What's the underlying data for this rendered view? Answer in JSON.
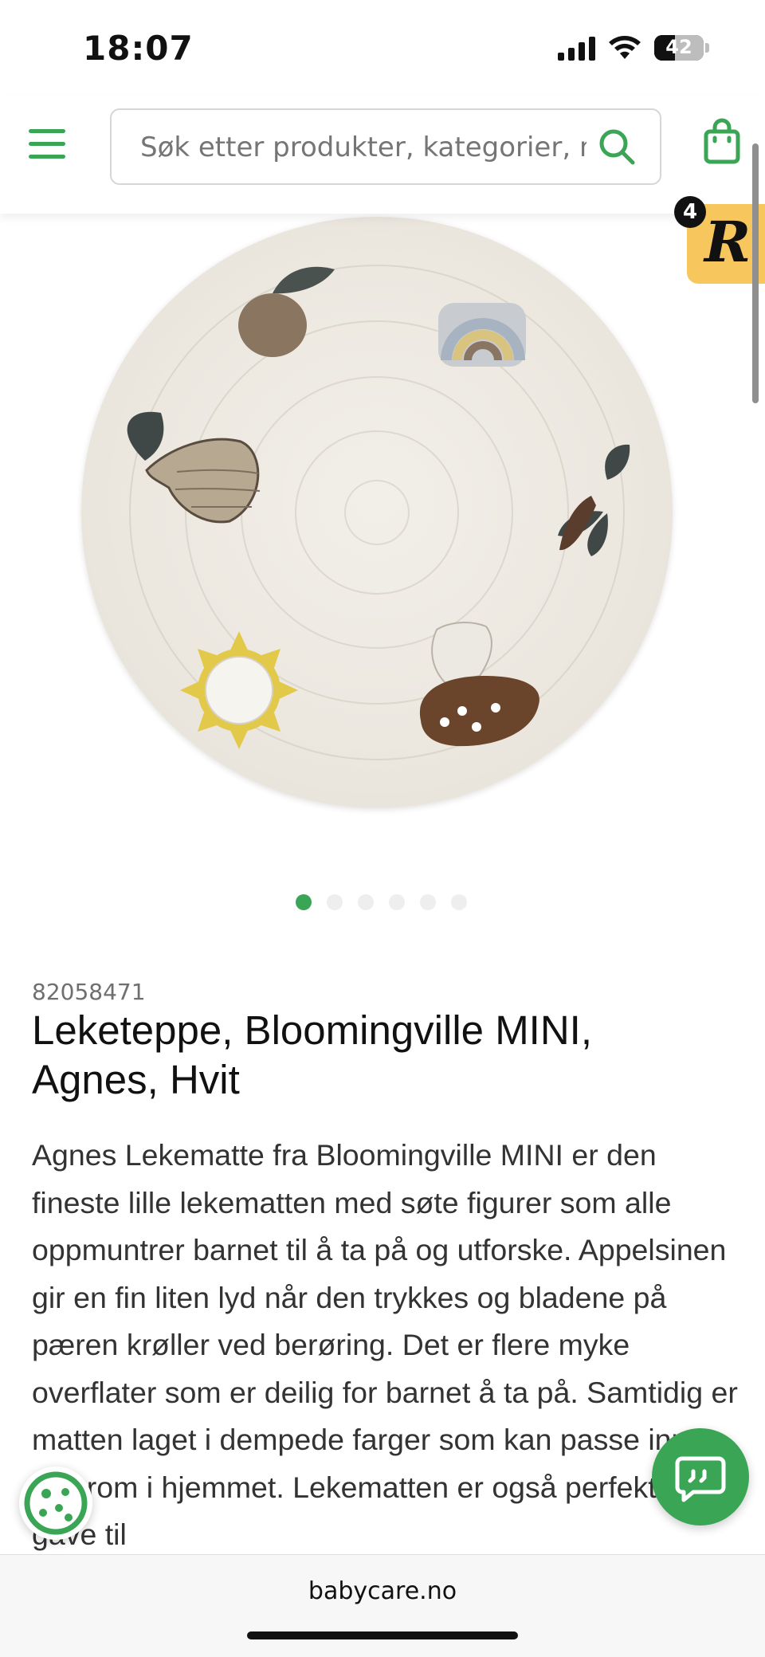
{
  "status_bar": {
    "time": "18:07",
    "battery": "42"
  },
  "header": {
    "search_placeholder": "Søk etter produkter, kategorier, merker"
  },
  "floating_badge": {
    "count": "4",
    "letter": "R"
  },
  "carousel": {
    "total": 6,
    "active": 1
  },
  "product": {
    "sku": "82058471",
    "title": "Leketeppe, Bloomingville MINI, Agnes, Hvit",
    "description": "Agnes Lekematte fra Bloomingville MINI er den fineste lille lekematten med søte figurer som alle oppmuntrer barnet til å ta på og utforske. Appelsinen gir en fin liten lyd når den trykkes og bladene på pæren krøller ved berøring. Det er flere myke overflater som er deilig for barnet å ta på. Samtidig er matten laget i dempede farger som kan passe inn i alle rom i hjemmet. Lekematten er også perfekt som gave til"
  },
  "browser": {
    "domain": "babycare.no"
  },
  "colors": {
    "brand_green": "#3aa655",
    "badge_yellow": "#f7c65c"
  }
}
